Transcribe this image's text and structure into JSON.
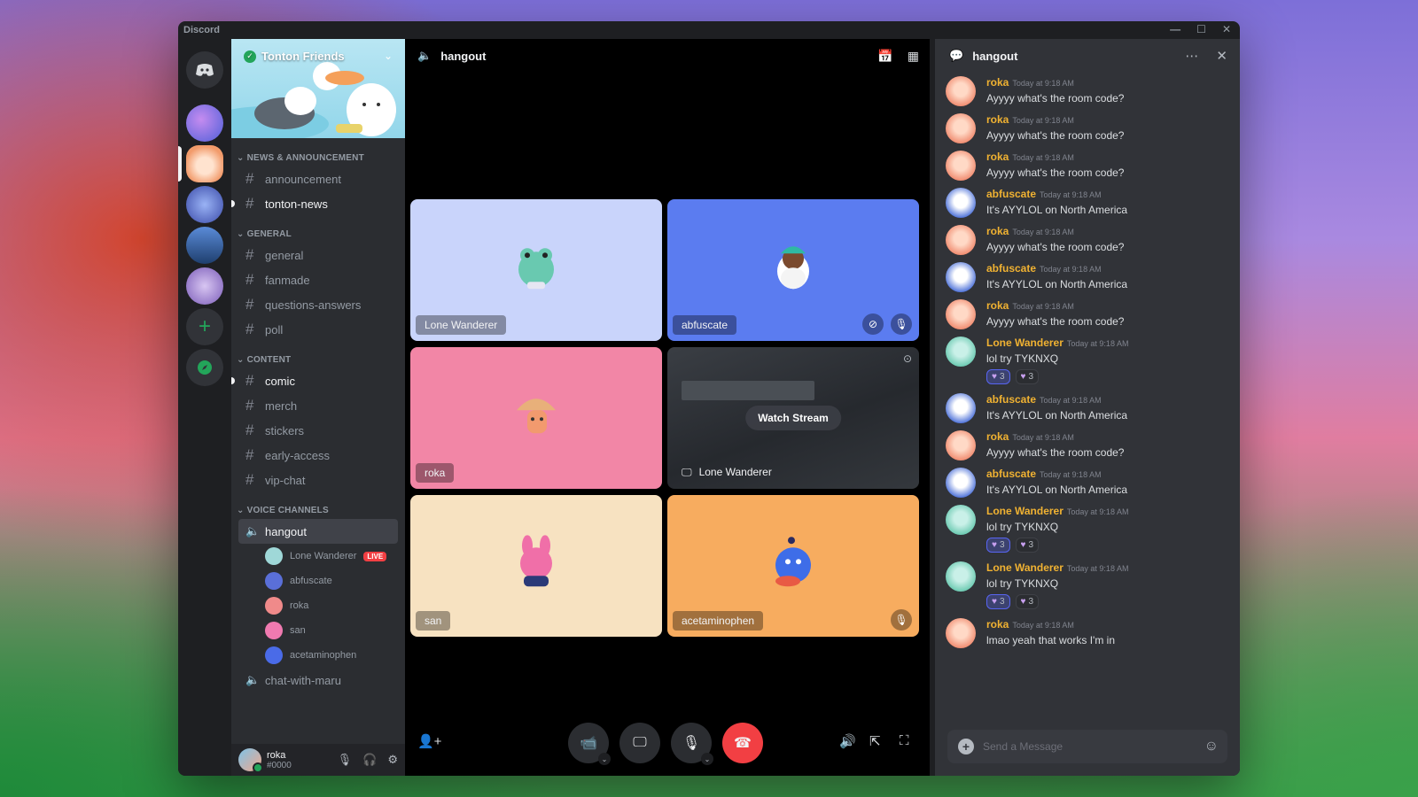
{
  "window": {
    "app_name": "Discord"
  },
  "colors": {
    "accent": "#5865f2",
    "online": "#23a55a",
    "danger": "#f23f43",
    "author": "#f0b232"
  },
  "server": {
    "name": "Tonton Friends"
  },
  "categories": {
    "news": "NEWS & ANNOUNCEMENT",
    "general": "GENERAL",
    "content": "CONTENT",
    "voice": "VOICE CHANNELS"
  },
  "channels": {
    "news": [
      "announcement",
      "tonton-news"
    ],
    "general": [
      "general",
      "fanmade",
      "questions-answers",
      "poll"
    ],
    "content": [
      "comic",
      "merch",
      "stickers",
      "early-access",
      "vip-chat"
    ],
    "voice": [
      "hangout",
      "chat-with-maru"
    ]
  },
  "voice_members": [
    "Lone Wanderer",
    "abfuscate",
    "roka",
    "san",
    "acetaminophen"
  ],
  "live_badge": "LIVE",
  "user": {
    "name": "roka",
    "tag": "#0000"
  },
  "stage": {
    "channel": "hangout",
    "tiles": {
      "t1": "Lone Wanderer",
      "t2": "abfuscate",
      "t3": "roka",
      "t4": "Lone Wanderer",
      "t5": "san",
      "t6": "acetaminophen"
    },
    "watch_stream": "Watch Stream"
  },
  "chat": {
    "title": "hangout",
    "placeholder": "Send a Message",
    "messages": [
      {
        "author": "roka",
        "time": "Today at 9:18 AM",
        "text": "Ayyyy what's the room code?"
      },
      {
        "author": "roka",
        "time": "Today at 9:18 AM",
        "text": "Ayyyy what's the room code?"
      },
      {
        "author": "roka",
        "time": "Today at 9:18 AM",
        "text": "Ayyyy what's the room code?"
      },
      {
        "author": "abfuscate",
        "time": "Today at 9:18 AM",
        "text": "It's AYYLOL on North America"
      },
      {
        "author": "roka",
        "time": "Today at 9:18 AM",
        "text": "Ayyyy what's the room code?"
      },
      {
        "author": "abfuscate",
        "time": "Today at 9:18 AM",
        "text": "It's AYYLOL on North America"
      },
      {
        "author": "roka",
        "time": "Today at 9:18 AM",
        "text": "Ayyyy what's the room code?"
      },
      {
        "author": "Lone Wanderer",
        "time": "Today at 9:18 AM",
        "text": "lol try TYKNXQ",
        "r1": "3",
        "r2": "3"
      },
      {
        "author": "abfuscate",
        "time": "Today at 9:18 AM",
        "text": "It's AYYLOL on North America"
      },
      {
        "author": "roka",
        "time": "Today at 9:18 AM",
        "text": "Ayyyy what's the room code?"
      },
      {
        "author": "abfuscate",
        "time": "Today at 9:18 AM",
        "text": "It's AYYLOL on North America"
      },
      {
        "author": "Lone Wanderer",
        "time": "Today at 9:18 AM",
        "text": "lol try TYKNXQ",
        "r1": "3",
        "r2": "3"
      },
      {
        "author": "Lone Wanderer",
        "time": "Today at 9:18 AM",
        "text": "lol try TYKNXQ",
        "r1": "3",
        "r2": "3"
      },
      {
        "author": "roka",
        "time": "Today at 9:18 AM",
        "text": "lmao yeah that works I'm in"
      }
    ]
  }
}
